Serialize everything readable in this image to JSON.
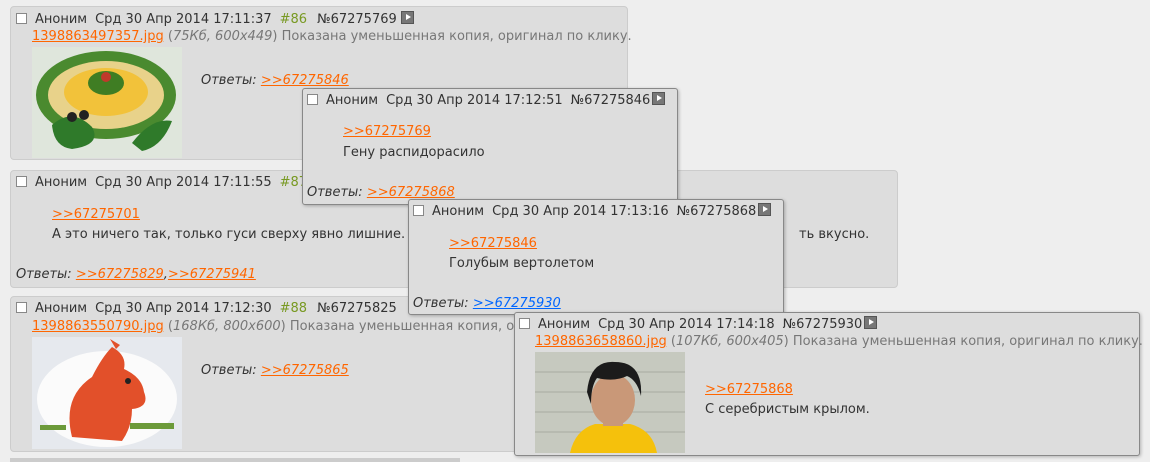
{
  "labels": {
    "replies": "Ответы:"
  },
  "posts": [
    {
      "name": "Аноним",
      "date": "Срд 30 Апр 2014 17:11:37",
      "index": "#86",
      "num": "№67275769",
      "file": {
        "name": "1398863497357.jpg",
        "size": "75Кб, 600x449",
        "note": "Показана уменьшенная копия, оригинал по клику."
      },
      "replies": [
        ">>67275846"
      ]
    },
    {
      "name": "Аноним",
      "date": "Срд 30 Апр 2014 17:11:55",
      "index": "#87",
      "quote": ">>67275701",
      "text": "А это ничего так, только гуси сверху явно лишние.",
      "text_tail": "ть вкусно.",
      "replies": [
        ">>67275829",
        ">>67275941"
      ]
    },
    {
      "name": "Аноним",
      "date": "Срд 30 Апр 2014 17:12:30",
      "index": "#88",
      "num": "№67275825",
      "file": {
        "name": "1398863550790.jpg",
        "size": "168Кб, 800x600",
        "note": "Показана уменьшенная копия, ор"
      },
      "replies": [
        ">>67275865"
      ]
    }
  ],
  "popups": [
    {
      "name": "Аноним",
      "date": "Срд 30 Апр 2014 17:12:51",
      "num": "№67275846",
      "quote": ">>67275769",
      "text": "Гену распидорасило",
      "replies": [
        ">>67275868"
      ]
    },
    {
      "name": "Аноним",
      "date": "Срд 30 Апр 2014 17:13:16",
      "num": "№67275868",
      "quote": ">>67275846",
      "text": "Голубым вертолетом",
      "replies": [
        ">>67275930"
      ]
    },
    {
      "name": "Аноним",
      "date": "Срд 30 Апр 2014 17:14:18",
      "num": "№67275930",
      "file": {
        "name": "1398863658860.jpg",
        "size": "107Кб, 600x405",
        "note": "Показана уменьшенная копия, оригинал по клику."
      },
      "quote": ">>67275868",
      "text": "С серебристым крылом."
    }
  ],
  "colors": {
    "background": "#eeeeee",
    "post": "#dddddd",
    "link": "#ff6600",
    "link_visited": "#0066ff",
    "post_index": "#789922"
  },
  "icons": {
    "expand": "play-arrow-icon",
    "checkbox": "checkbox-icon"
  }
}
